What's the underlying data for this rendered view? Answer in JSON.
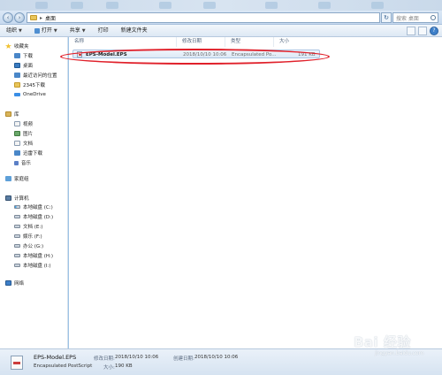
{
  "address_bar": {
    "path": "桌面",
    "search_placeholder": "搜索 桌面"
  },
  "toolbar": {
    "organize": "组织",
    "open": "打开",
    "share": "共享",
    "print": "打印",
    "new_folder": "新建文件夹"
  },
  "sidebar": {
    "favorites_header": "收藏夹",
    "favorites": [
      "下载",
      "桌面",
      "最近访问的位置",
      "2345下载",
      "OneDrive"
    ],
    "libraries_header": "库",
    "libraries": [
      "视频",
      "图片",
      "文档",
      "迅雷下载",
      "音乐"
    ],
    "homegroup": "家庭组",
    "computer_header": "计算机",
    "drives": [
      "本地磁盘 (C:)",
      "本地磁盘 (D:)",
      "文档 (E:)",
      "娱乐 (F:)",
      "办公 (G:)",
      "本地磁盘 (H:)",
      "本地磁盘 (I:)"
    ],
    "network": "网络"
  },
  "columns": {
    "name": "名称",
    "modified": "修改日期",
    "type": "类型",
    "size": "大小"
  },
  "files": [
    {
      "name": "EPS-Model.EPS",
      "modified": "2018/10/10 10:06",
      "type": "Encapsulated Po...",
      "size": "191 KB"
    }
  ],
  "details": {
    "name": "EPS-Model.EPS",
    "type": "Encapsulated PostScript",
    "modified_label": "修改日期:",
    "modified_value": "2018/10/10 10:06",
    "created_label": "创建日期:",
    "created_value": "2018/10/10 10:06",
    "size_label": "大小:",
    "size_value": "190 KB"
  },
  "watermark": {
    "text": "Bai 经验",
    "sub": "jingyan.baidu.com"
  },
  "colors": {
    "highlight": "#e0202a",
    "selection": "#dde9f6",
    "accent": "#3d7fc9"
  }
}
